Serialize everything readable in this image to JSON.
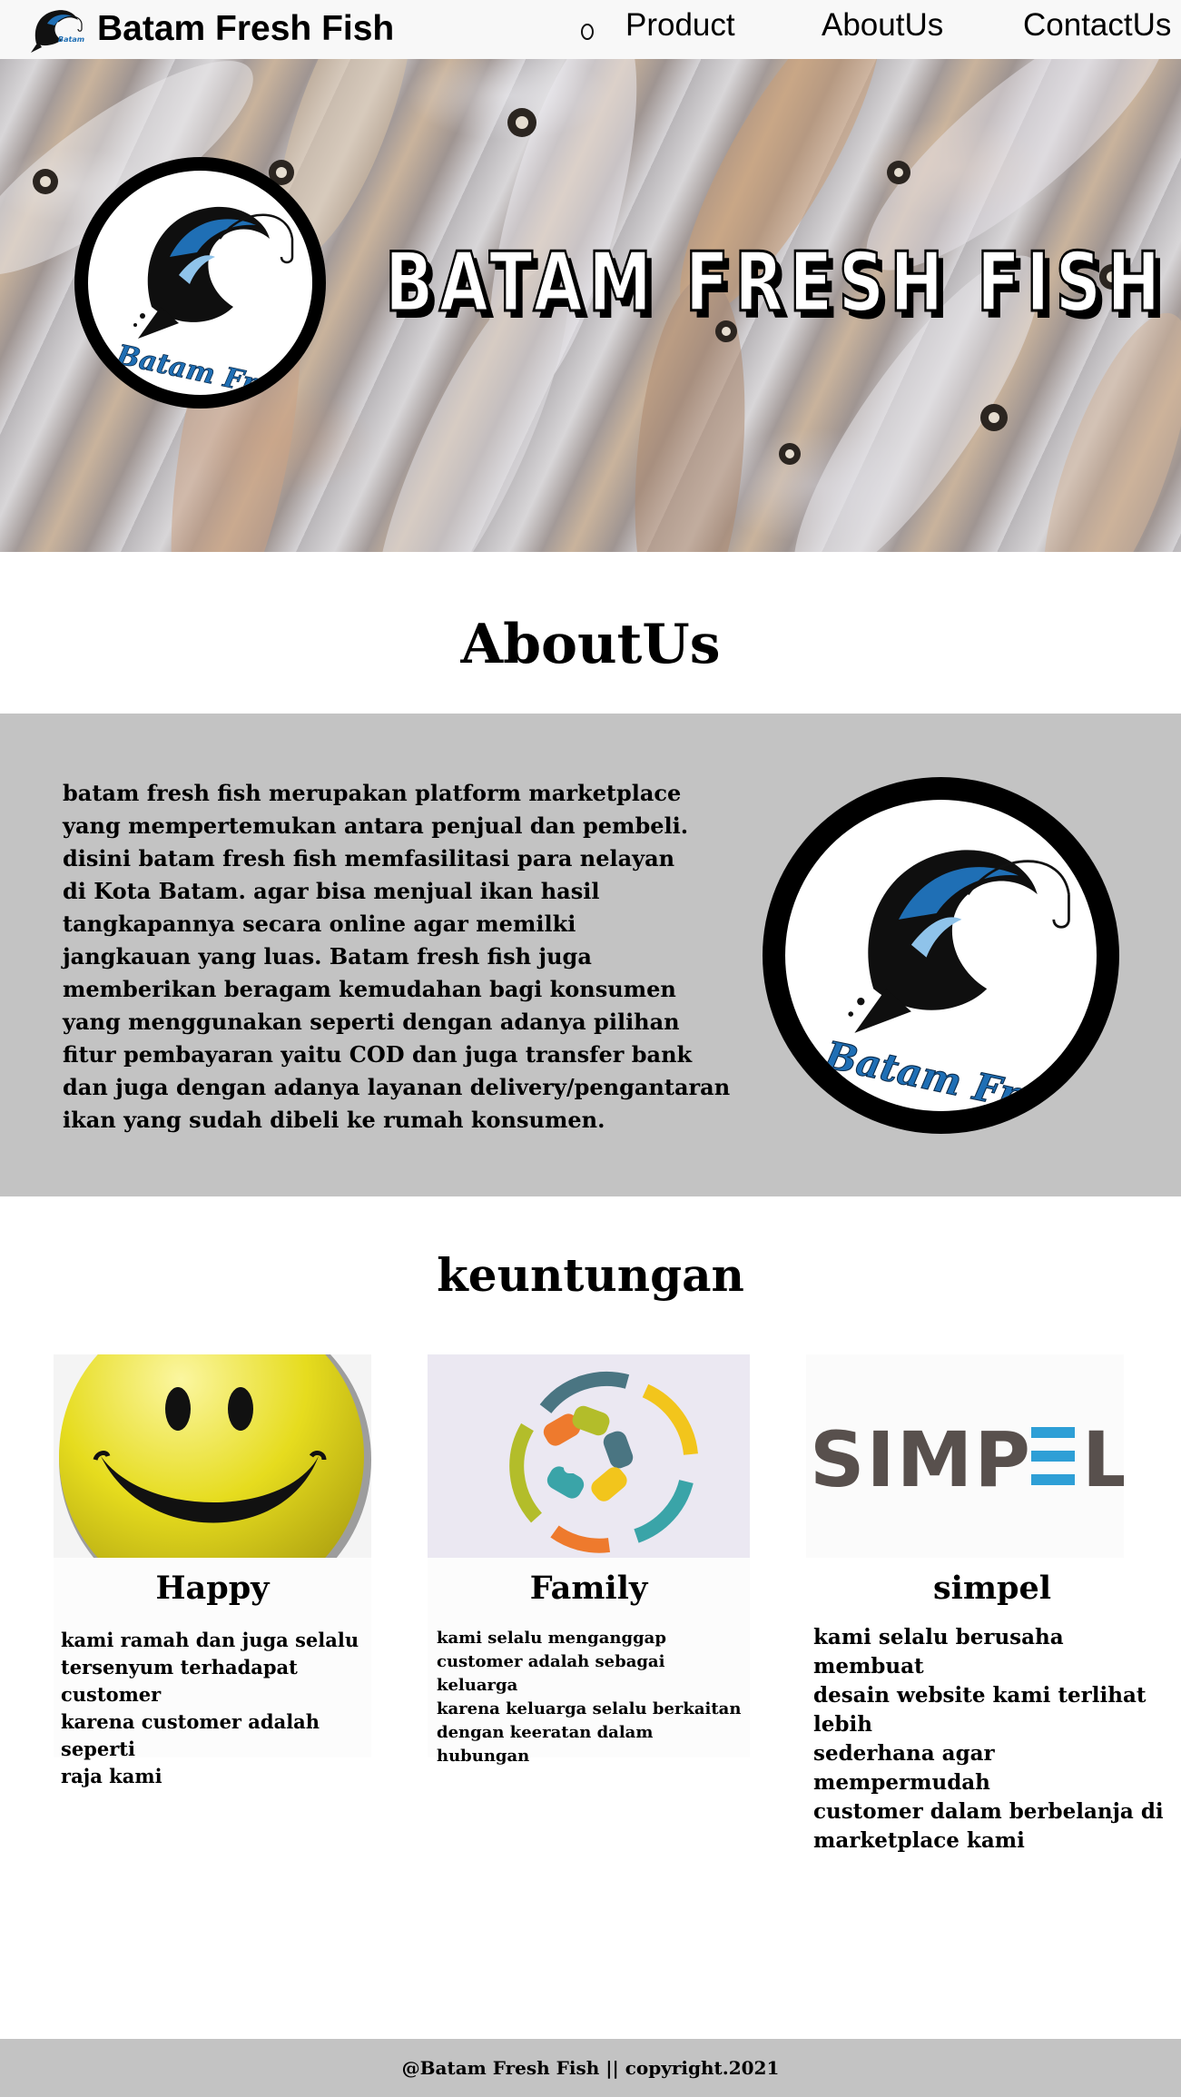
{
  "nav": {
    "brand": "Batam Fresh Fish",
    "logo_text": "Batam Fresh Fish",
    "links": [
      "Product",
      "AboutUs",
      "ContactUs"
    ]
  },
  "hero": {
    "title": "BATAM FRESH FISH",
    "logo_text": "Batam Fresh Fish"
  },
  "about": {
    "heading": "AboutUs",
    "text": "batam fresh fish merupakan platform marketplace\nyang mempertemukan antara penjual dan pembeli.\ndisini batam fresh fish memfasilitasi para nelayan\ndi Kota Batam. agar bisa menjual ikan hasil\ntangkapannya secara online agar memilki\njangkauan yang luas. Batam fresh fish juga\nmemberikan beragam kemudahan bagi konsumen\nyang menggunakan seperti dengan adanya pilihan\nfitur pembayaran yaitu COD dan juga transfer bank\ndan juga dengan adanya layanan delivery/pengantaran\n ikan yang sudah dibeli ke rumah konsumen.",
    "logo_text": "Batam Fresh Fish"
  },
  "benefits": {
    "heading": "keuntungan",
    "cards": [
      {
        "title": "Happy",
        "text": "kami ramah dan juga selalu\ntersenyum terhadapat customer\nkarena customer adalah seperti\nraja kami"
      },
      {
        "title": "Family",
        "text": "kami selalu menganggap\ncustomer adalah sebagai keluarga\nkarena keluarga selalu berkaitan\ndengan keeratan dalam hubungan"
      },
      {
        "title": "simpel",
        "image_text": "SIMPEL",
        "text": "kami selalu berusaha membuat\ndesain website kami terlihat lebih\nsederhana agar mempermudah\ncustomer dalam berbelanja di\nmarketplace kami"
      }
    ]
  },
  "footer": {
    "text": "@Batam Fresh Fish || copyright.2021"
  },
  "colors": {
    "nav_bg": "#f8f8f8",
    "band_bg": "#c3c3c3",
    "logo_blue": "#1f6fb5",
    "smiley_yellow": "#e6dc1e",
    "simpel_gray": "#58504d",
    "simpel_blue": "#2e9fd6"
  },
  "icons": [
    "fish-logo-icon",
    "smiley-icon",
    "family-hands-icon",
    "simpel-logo"
  ]
}
